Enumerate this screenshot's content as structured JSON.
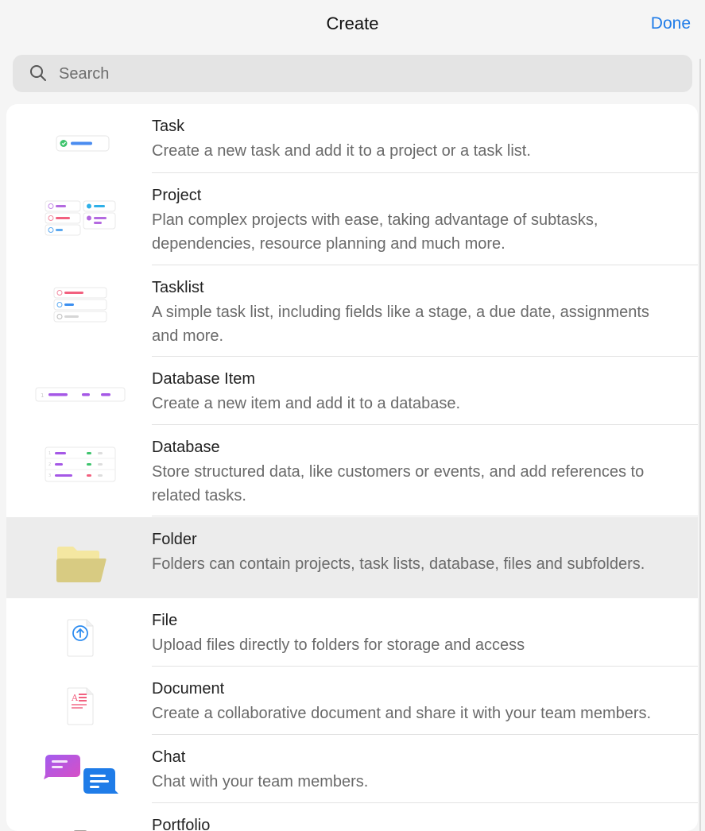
{
  "header": {
    "title": "Create",
    "done_label": "Done"
  },
  "search": {
    "placeholder": "Search",
    "value": ""
  },
  "items": [
    {
      "name": "Task",
      "desc": "Create a new task and add it to a project or a task list.",
      "icon": "task-icon"
    },
    {
      "name": "Project",
      "desc": "Plan complex projects with ease, taking advantage of subtasks, dependencies, resource planning and much more.",
      "icon": "project-icon"
    },
    {
      "name": "Tasklist",
      "desc": "A simple task list, including fields like a stage, a due date, assignments and more.",
      "icon": "tasklist-icon"
    },
    {
      "name": "Database Item",
      "desc": "Create a new item and add it to a database.",
      "icon": "database-item-icon"
    },
    {
      "name": "Database",
      "desc": "Store structured data, like customers or events, and add references to related tasks.",
      "icon": "database-icon"
    },
    {
      "name": "Folder",
      "desc": "Folders can contain projects, task lists, database, files and subfolders.",
      "icon": "folder-icon",
      "selected": true
    },
    {
      "name": "File",
      "desc": "Upload files directly to folders for storage and access",
      "icon": "file-upload-icon"
    },
    {
      "name": "Document",
      "desc": "Create a collaborative document and share it with your team members.",
      "icon": "document-icon"
    },
    {
      "name": "Chat",
      "desc": "Chat with your team members.",
      "icon": "chat-icon"
    },
    {
      "name": "Portfolio",
      "desc": "",
      "icon": "portfolio-icon"
    }
  ]
}
